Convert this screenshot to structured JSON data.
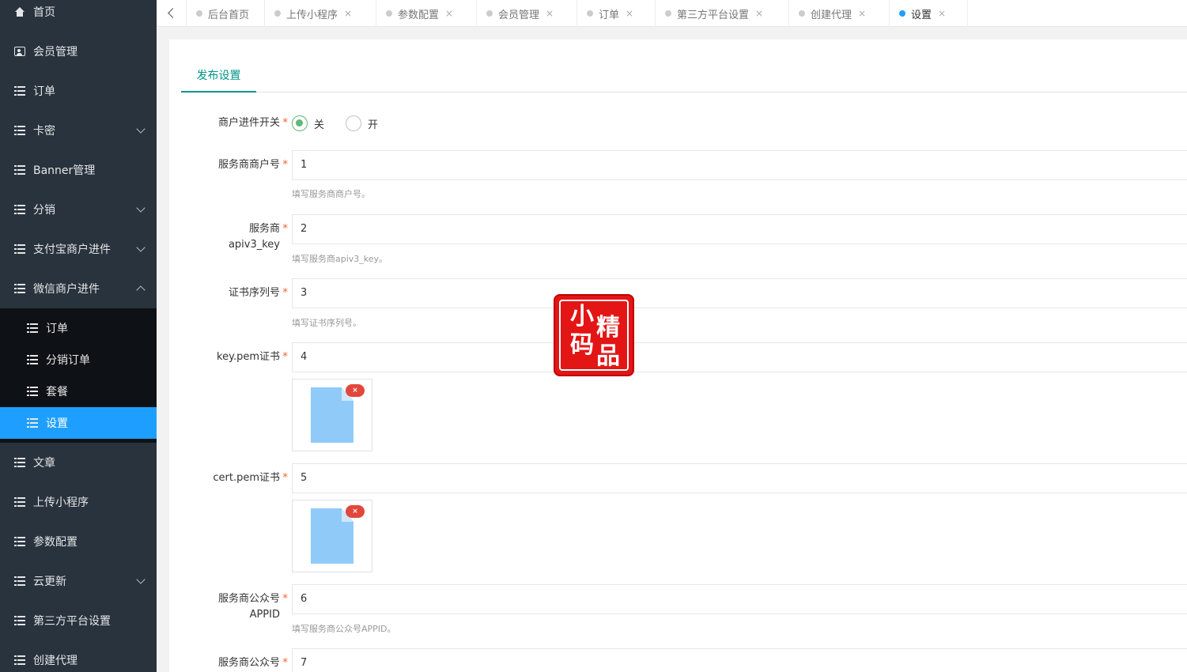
{
  "sidebar": {
    "items": [
      {
        "label": "首页",
        "icon": "home-icon"
      },
      {
        "label": "会员管理",
        "icon": "user-card-icon"
      },
      {
        "label": "订单",
        "icon": "list-icon"
      },
      {
        "label": "卡密",
        "icon": "list-icon",
        "expandable": true
      },
      {
        "label": "Banner管理",
        "icon": "list-icon"
      },
      {
        "label": "分销",
        "icon": "list-icon",
        "expandable": true
      },
      {
        "label": "支付宝商户进件",
        "icon": "list-icon",
        "expandable": true
      },
      {
        "label": "微信商户进件",
        "icon": "list-icon",
        "expanded": true
      }
    ],
    "submenu": [
      {
        "label": "订单"
      },
      {
        "label": "分销订单"
      },
      {
        "label": "套餐"
      },
      {
        "label": "设置",
        "active": true
      }
    ],
    "items_after": [
      {
        "label": "文章"
      },
      {
        "label": "上传小程序"
      },
      {
        "label": "参数配置"
      },
      {
        "label": "云更新",
        "expandable": true
      },
      {
        "label": "第三方平台设置"
      },
      {
        "label": "创建代理"
      }
    ],
    "active_color": "#1e9fff"
  },
  "tabs": [
    {
      "label": "后台首页",
      "closable": false
    },
    {
      "label": "上传小程序",
      "closable": true
    },
    {
      "label": "参数配置",
      "closable": true
    },
    {
      "label": "会员管理",
      "closable": true
    },
    {
      "label": "订单",
      "closable": true
    },
    {
      "label": "第三方平台设置",
      "closable": true
    },
    {
      "label": "创建代理",
      "closable": true
    },
    {
      "label": "设置",
      "closable": true,
      "active": true
    }
  ],
  "tab_close_glyph": "×",
  "form": {
    "subtab": "发布设置",
    "switch_label": "商户进件开关",
    "switch_options": [
      "关",
      "开"
    ],
    "switch_value": "关",
    "required_mark": "*",
    "fields": [
      {
        "label": "服务商商户号",
        "value": "1",
        "tip": "填写服务商商户号。"
      },
      {
        "label_line1": "服务商",
        "label_line2": "apiv3_key",
        "value": "2",
        "tip": "填写服务商apiv3_key。"
      },
      {
        "label": "证书序列号",
        "value": "3",
        "tip": "填写证书序列号。"
      },
      {
        "label": "key.pem证书",
        "value": "4"
      },
      {
        "label": "cert.pem证书",
        "value": "5"
      },
      {
        "label_line1": "服务商公众号",
        "label_line2": "APPID",
        "value": "6",
        "tip": "填写服务商公众号APPID。"
      },
      {
        "label": "服务商公众号",
        "value": "7"
      }
    ],
    "upload_delete_glyph": "×"
  },
  "watermark": {
    "chars": [
      "小",
      "精",
      "码",
      "品"
    ],
    "color": "#e31515"
  }
}
